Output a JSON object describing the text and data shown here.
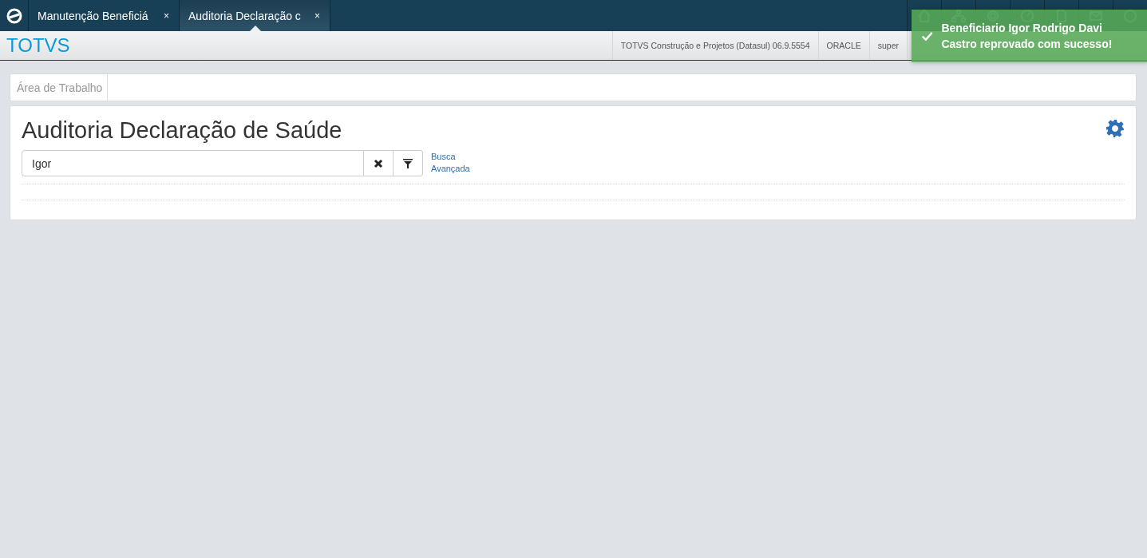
{
  "tabs": [
    {
      "label": "Manutenção Beneficiá",
      "close": "×",
      "selected": false
    },
    {
      "label": "Auditoria Declaração c",
      "close": "×",
      "selected": true
    }
  ],
  "header": {
    "brand": "TOTVS",
    "info": [
      "TOTVS Construção e Projetos (Datasul) 06.9.5554",
      "ORACLE",
      "super"
    ]
  },
  "toast": {
    "message": "Beneficiario Igor Rodrigo Davi Castro reprovado com sucesso!"
  },
  "breadcrumb": [
    "Área de Trabalho"
  ],
  "page": {
    "title": "Auditoria Declaração de Saúde",
    "search": {
      "value": "Igor"
    },
    "advanced_link": "Busca Avançada"
  }
}
